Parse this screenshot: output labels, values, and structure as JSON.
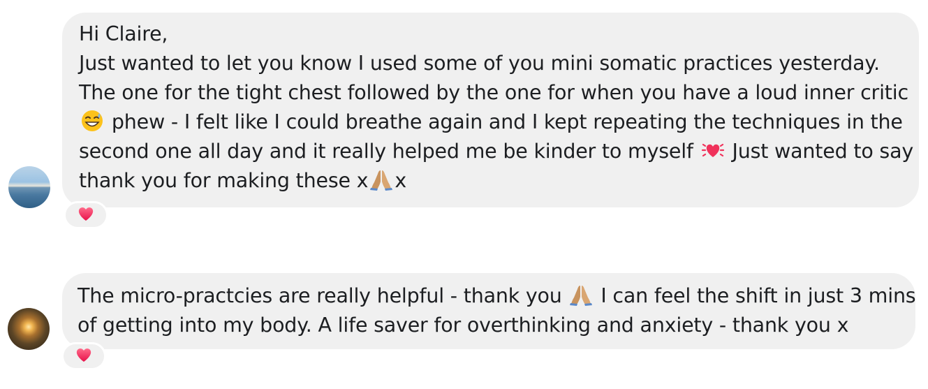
{
  "messages": [
    {
      "avatar_icon": "beach-photo-avatar",
      "lines": [
        [
          "Hi Claire,"
        ],
        [
          "Just wanted to let you know I used some of you mini somatic practices yesterday."
        ],
        [
          "The one for the tight chest followed by the one for when you have a loud inner critic"
        ],
        [
          " phew - I felt like I could breathe again and I kept repeating the techniques in the"
        ],
        [
          "second one all day and it really helped me be kinder to myself ",
          " Just wanted to say"
        ],
        [
          "thank you for making these x",
          "x"
        ]
      ],
      "emojis": [
        "grinning-sweat-emoji",
        "beating-heart-emoji",
        "folded-hands-emoji"
      ],
      "reaction": "heart-reaction"
    },
    {
      "avatar_icon": "sunset-photo-avatar",
      "lines": [
        [
          "The micro-practcies are really helpful - thank you ",
          " I can feel the shift in just 3 mins"
        ],
        [
          "of getting into my body. A life saver for overthinking and anxiety - thank you x"
        ]
      ],
      "emojis": [
        "folded-hands-emoji"
      ],
      "reaction": "heart-reaction"
    }
  ],
  "colors": {
    "bubble": "#f0f0f0",
    "text": "#1c1e21",
    "heart": "#f0325b"
  }
}
